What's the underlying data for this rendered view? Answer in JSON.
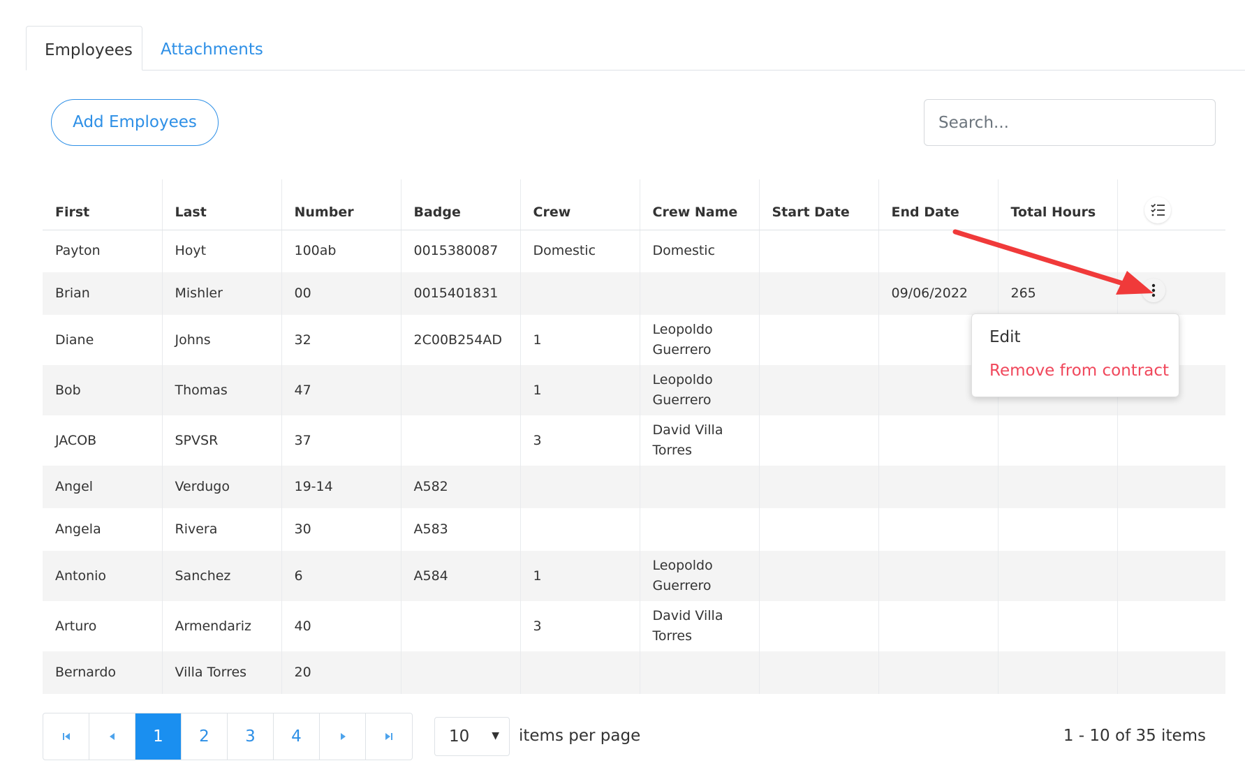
{
  "tabs": [
    {
      "label": "Employees",
      "active": true
    },
    {
      "label": "Attachments",
      "active": false
    }
  ],
  "toolbar": {
    "add_label": "Add Employees",
    "search_placeholder": "Search..."
  },
  "table": {
    "columns": [
      "First",
      "Last",
      "Number",
      "Badge",
      "Crew",
      "Crew Name",
      "Start Date",
      "End Date",
      "Total Hours"
    ],
    "rows": [
      {
        "first": "Payton",
        "last": "Hoyt",
        "number": "100ab",
        "badge": "0015380087",
        "crew": "Domestic",
        "crew_name_1": "Domestic",
        "crew_name_2": "",
        "start_date": "",
        "end_date": "",
        "total_hours": ""
      },
      {
        "first": "Brian",
        "last": "Mishler",
        "number": "00",
        "badge": "0015401831",
        "crew": "",
        "crew_name_1": "",
        "crew_name_2": "",
        "start_date": "",
        "end_date": "09/06/2022",
        "total_hours": "265"
      },
      {
        "first": "Diane",
        "last": "Johns",
        "number": "32",
        "badge": "2C00B254AD",
        "crew": "1",
        "crew_name_1": "Leopoldo",
        "crew_name_2": "Guerrero",
        "start_date": "",
        "end_date": "",
        "total_hours": ""
      },
      {
        "first": "Bob",
        "last": "Thomas",
        "number": "47",
        "badge": "",
        "crew": "1",
        "crew_name_1": "Leopoldo",
        "crew_name_2": "Guerrero",
        "start_date": "",
        "end_date": "",
        "total_hours": ""
      },
      {
        "first": "JACOB",
        "last": "SPVSR",
        "number": "37",
        "badge": "",
        "crew": "3",
        "crew_name_1": "David Villa",
        "crew_name_2": "Torres",
        "start_date": "",
        "end_date": "",
        "total_hours": ""
      },
      {
        "first": "Angel",
        "last": "Verdugo",
        "number": "19-14",
        "badge": "A582",
        "crew": "",
        "crew_name_1": "",
        "crew_name_2": "",
        "start_date": "",
        "end_date": "",
        "total_hours": ""
      },
      {
        "first": "Angela",
        "last": "Rivera",
        "number": "30",
        "badge": "A583",
        "crew": "",
        "crew_name_1": "",
        "crew_name_2": "",
        "start_date": "",
        "end_date": "",
        "total_hours": ""
      },
      {
        "first": "Antonio",
        "last": "Sanchez",
        "number": "6",
        "badge": "A584",
        "crew": "1",
        "crew_name_1": "Leopoldo",
        "crew_name_2": "Guerrero",
        "start_date": "",
        "end_date": "",
        "total_hours": ""
      },
      {
        "first": "Arturo",
        "last": "Armendariz",
        "number": "40",
        "badge": "",
        "crew": "3",
        "crew_name_1": "David Villa",
        "crew_name_2": "Torres",
        "start_date": "",
        "end_date": "",
        "total_hours": ""
      },
      {
        "first": "Bernardo",
        "last": "Villa Torres",
        "number": "20",
        "badge": "",
        "crew": "",
        "crew_name_1": "",
        "crew_name_2": "",
        "start_date": "",
        "end_date": "",
        "total_hours": ""
      }
    ]
  },
  "context_menu": {
    "edit_label": "Edit",
    "remove_label": "Remove from contract",
    "remove_color": "#f0475b"
  },
  "pager": {
    "pages": [
      "1",
      "2",
      "3",
      "4"
    ],
    "current": "1",
    "per_page": "10",
    "per_page_label": "items per page",
    "range_label": "1 - 10 of 35 items"
  },
  "icons": {
    "first_page": "first-page-icon",
    "prev_page": "prev-page-icon",
    "next_page": "next-page-icon",
    "last_page": "last-page-icon",
    "column_menu": "checklist-icon",
    "row_menu": "kebab-icon",
    "annotation": "red-arrow-icon"
  },
  "colors": {
    "accent": "#2d8fe6",
    "active_page": "#1a8ff0",
    "alt_row": "#f4f4f4",
    "arrow": "#f03a3a"
  }
}
